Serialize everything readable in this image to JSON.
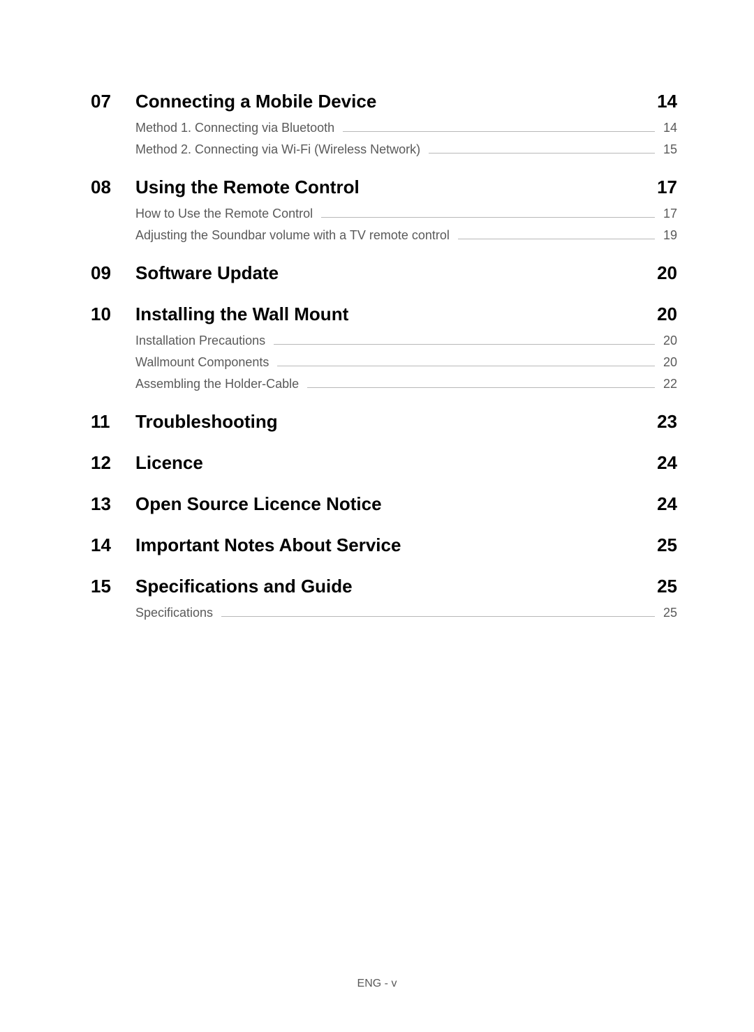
{
  "sections": [
    {
      "number": "07",
      "title": "Connecting a Mobile Device",
      "page": "14",
      "subs": [
        {
          "title": "Method 1. Connecting via Bluetooth",
          "page": "14"
        },
        {
          "title": "Method 2. Connecting via Wi-Fi (Wireless Network)",
          "page": "15"
        }
      ]
    },
    {
      "number": "08",
      "title": "Using the Remote Control",
      "page": "17",
      "subs": [
        {
          "title": "How to Use the Remote Control",
          "page": "17"
        },
        {
          "title": "Adjusting the Soundbar volume with a TV remote control",
          "page": "19"
        }
      ]
    },
    {
      "number": "09",
      "title": "Software Update",
      "page": "20",
      "subs": []
    },
    {
      "number": "10",
      "title": "Installing the Wall Mount",
      "page": "20",
      "subs": [
        {
          "title": "Installation Precautions",
          "page": "20"
        },
        {
          "title": "Wallmount Components",
          "page": "20"
        },
        {
          "title": "Assembling the Holder-Cable",
          "page": "22"
        }
      ]
    },
    {
      "number": "11",
      "title": "Troubleshooting",
      "page": "23",
      "subs": []
    },
    {
      "number": "12",
      "title": "Licence",
      "page": "24",
      "subs": []
    },
    {
      "number": "13",
      "title": "Open Source Licence Notice",
      "page": "24",
      "subs": []
    },
    {
      "number": "14",
      "title": "Important Notes About Service",
      "page": "25",
      "subs": []
    },
    {
      "number": "15",
      "title": "Specifications and Guide",
      "page": "25",
      "subs": [
        {
          "title": "Specifications",
          "page": "25"
        }
      ]
    }
  ],
  "footer": "ENG - v"
}
